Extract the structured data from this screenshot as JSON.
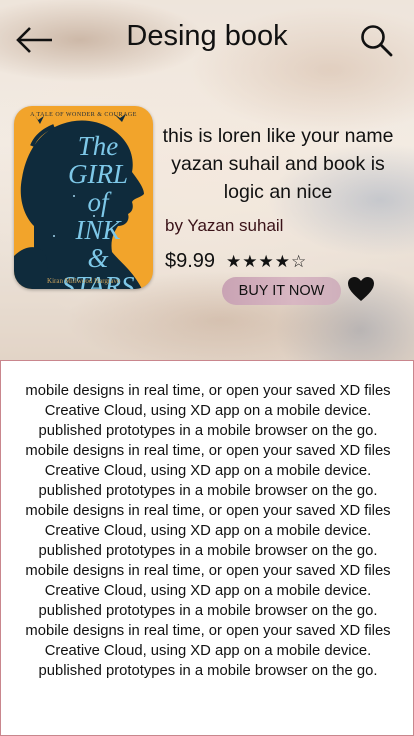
{
  "header": {
    "title": "Desing book",
    "back_icon": "arrow-left-icon",
    "search_icon": "search-icon"
  },
  "book": {
    "cover": {
      "tagline": "A TALE OF WONDER & COURAGE",
      "title_lines": [
        "The",
        "GIRL",
        "of",
        "INK",
        "&",
        "STARS"
      ],
      "author": "Kiran Millwood Hargrave"
    },
    "description": "this is loren like your name yazan suhail and book is logic an nice",
    "author": "by Yazan suhail",
    "price": "$9.99",
    "rating": 4,
    "rating_max": 5,
    "buy_label": "BUY IT NOW",
    "favorite_icon": "heart-icon"
  },
  "colors": {
    "cover_bg": "#f2a42b",
    "buy_button": "#d3b1bf",
    "section_border": "#c9868d"
  },
  "details": {
    "lines": [
      "mobile designs in real time, or open your saved XD files",
      "Creative Cloud, using XD app on a mobile device.",
      "published prototypes in a mobile browser on the go.",
      "mobile designs in real time, or open your saved XD files",
      "Creative Cloud, using XD app on a mobile device.",
      "published prototypes in a mobile browser on the go.",
      "mobile designs in real time, or open your saved XD files",
      "Creative Cloud, using XD app on a mobile device.",
      "published prototypes in a mobile browser on the go.",
      "mobile designs in real time, or open your saved XD files",
      "Creative Cloud, using XD app on a mobile device.",
      "published prototypes in a mobile browser on the go.",
      "mobile designs in real time, or open your saved XD files",
      "Creative Cloud, using XD app on a mobile device.",
      "published prototypes in a mobile browser on the go."
    ]
  }
}
